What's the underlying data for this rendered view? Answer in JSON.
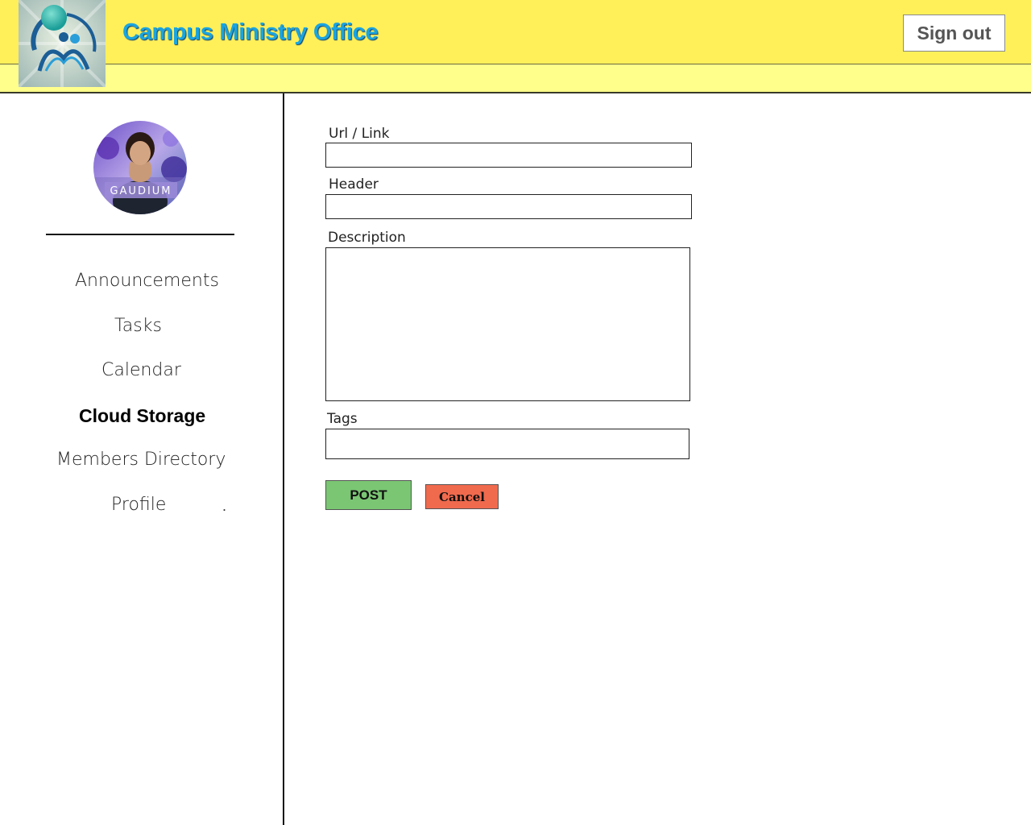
{
  "header": {
    "title": "Campus Ministry Office",
    "signout_label": "Sign out"
  },
  "sidebar": {
    "avatar_caption": "GAUDIUM",
    "items": [
      {
        "label": "Announcements",
        "active": false
      },
      {
        "label": "Tasks",
        "active": false
      },
      {
        "label": "Calendar",
        "active": false
      },
      {
        "label": "Cloud Storage",
        "active": true
      },
      {
        "label": "Members Directory",
        "active": false
      },
      {
        "label": "Profile",
        "active": false
      }
    ],
    "trailing_dot": "."
  },
  "form": {
    "url_label": "Url / Link",
    "url_value": "",
    "header_label": "Header",
    "header_value": "",
    "description_label": "Description",
    "description_value": "",
    "tags_label": "Tags",
    "tags_value": "",
    "post_label": "POST",
    "cancel_label": "Cancel"
  },
  "colors": {
    "header_bg": "#fff05a",
    "subheader_bg": "#ffff8c",
    "title": "#1aa4e0",
    "post_button": "#7ac673",
    "cancel_button": "#f06a4e"
  },
  "icons": {
    "logo": "campus-ministry-logo",
    "avatar": "user-avatar-photo"
  }
}
